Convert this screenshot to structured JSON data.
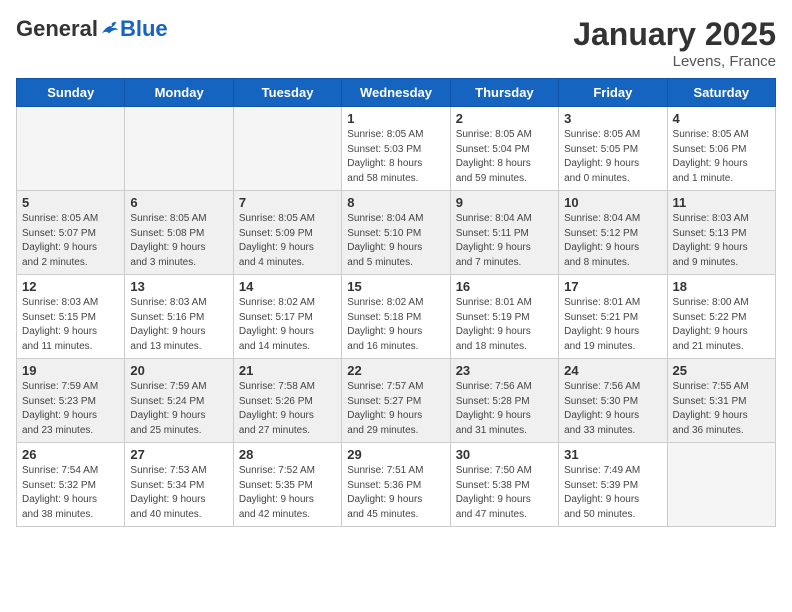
{
  "logo": {
    "general": "General",
    "blue": "Blue"
  },
  "title": "January 2025",
  "subtitle": "Levens, France",
  "weekdays": [
    "Sunday",
    "Monday",
    "Tuesday",
    "Wednesday",
    "Thursday",
    "Friday",
    "Saturday"
  ],
  "weeks": [
    [
      {
        "day": "",
        "info": ""
      },
      {
        "day": "",
        "info": ""
      },
      {
        "day": "",
        "info": ""
      },
      {
        "day": "1",
        "info": "Sunrise: 8:05 AM\nSunset: 5:03 PM\nDaylight: 8 hours\nand 58 minutes."
      },
      {
        "day": "2",
        "info": "Sunrise: 8:05 AM\nSunset: 5:04 PM\nDaylight: 8 hours\nand 59 minutes."
      },
      {
        "day": "3",
        "info": "Sunrise: 8:05 AM\nSunset: 5:05 PM\nDaylight: 9 hours\nand 0 minutes."
      },
      {
        "day": "4",
        "info": "Sunrise: 8:05 AM\nSunset: 5:06 PM\nDaylight: 9 hours\nand 1 minute."
      }
    ],
    [
      {
        "day": "5",
        "info": "Sunrise: 8:05 AM\nSunset: 5:07 PM\nDaylight: 9 hours\nand 2 minutes."
      },
      {
        "day": "6",
        "info": "Sunrise: 8:05 AM\nSunset: 5:08 PM\nDaylight: 9 hours\nand 3 minutes."
      },
      {
        "day": "7",
        "info": "Sunrise: 8:05 AM\nSunset: 5:09 PM\nDaylight: 9 hours\nand 4 minutes."
      },
      {
        "day": "8",
        "info": "Sunrise: 8:04 AM\nSunset: 5:10 PM\nDaylight: 9 hours\nand 5 minutes."
      },
      {
        "day": "9",
        "info": "Sunrise: 8:04 AM\nSunset: 5:11 PM\nDaylight: 9 hours\nand 7 minutes."
      },
      {
        "day": "10",
        "info": "Sunrise: 8:04 AM\nSunset: 5:12 PM\nDaylight: 9 hours\nand 8 minutes."
      },
      {
        "day": "11",
        "info": "Sunrise: 8:03 AM\nSunset: 5:13 PM\nDaylight: 9 hours\nand 9 minutes."
      }
    ],
    [
      {
        "day": "12",
        "info": "Sunrise: 8:03 AM\nSunset: 5:15 PM\nDaylight: 9 hours\nand 11 minutes."
      },
      {
        "day": "13",
        "info": "Sunrise: 8:03 AM\nSunset: 5:16 PM\nDaylight: 9 hours\nand 13 minutes."
      },
      {
        "day": "14",
        "info": "Sunrise: 8:02 AM\nSunset: 5:17 PM\nDaylight: 9 hours\nand 14 minutes."
      },
      {
        "day": "15",
        "info": "Sunrise: 8:02 AM\nSunset: 5:18 PM\nDaylight: 9 hours\nand 16 minutes."
      },
      {
        "day": "16",
        "info": "Sunrise: 8:01 AM\nSunset: 5:19 PM\nDaylight: 9 hours\nand 18 minutes."
      },
      {
        "day": "17",
        "info": "Sunrise: 8:01 AM\nSunset: 5:21 PM\nDaylight: 9 hours\nand 19 minutes."
      },
      {
        "day": "18",
        "info": "Sunrise: 8:00 AM\nSunset: 5:22 PM\nDaylight: 9 hours\nand 21 minutes."
      }
    ],
    [
      {
        "day": "19",
        "info": "Sunrise: 7:59 AM\nSunset: 5:23 PM\nDaylight: 9 hours\nand 23 minutes."
      },
      {
        "day": "20",
        "info": "Sunrise: 7:59 AM\nSunset: 5:24 PM\nDaylight: 9 hours\nand 25 minutes."
      },
      {
        "day": "21",
        "info": "Sunrise: 7:58 AM\nSunset: 5:26 PM\nDaylight: 9 hours\nand 27 minutes."
      },
      {
        "day": "22",
        "info": "Sunrise: 7:57 AM\nSunset: 5:27 PM\nDaylight: 9 hours\nand 29 minutes."
      },
      {
        "day": "23",
        "info": "Sunrise: 7:56 AM\nSunset: 5:28 PM\nDaylight: 9 hours\nand 31 minutes."
      },
      {
        "day": "24",
        "info": "Sunrise: 7:56 AM\nSunset: 5:30 PM\nDaylight: 9 hours\nand 33 minutes."
      },
      {
        "day": "25",
        "info": "Sunrise: 7:55 AM\nSunset: 5:31 PM\nDaylight: 9 hours\nand 36 minutes."
      }
    ],
    [
      {
        "day": "26",
        "info": "Sunrise: 7:54 AM\nSunset: 5:32 PM\nDaylight: 9 hours\nand 38 minutes."
      },
      {
        "day": "27",
        "info": "Sunrise: 7:53 AM\nSunset: 5:34 PM\nDaylight: 9 hours\nand 40 minutes."
      },
      {
        "day": "28",
        "info": "Sunrise: 7:52 AM\nSunset: 5:35 PM\nDaylight: 9 hours\nand 42 minutes."
      },
      {
        "day": "29",
        "info": "Sunrise: 7:51 AM\nSunset: 5:36 PM\nDaylight: 9 hours\nand 45 minutes."
      },
      {
        "day": "30",
        "info": "Sunrise: 7:50 AM\nSunset: 5:38 PM\nDaylight: 9 hours\nand 47 minutes."
      },
      {
        "day": "31",
        "info": "Sunrise: 7:49 AM\nSunset: 5:39 PM\nDaylight: 9 hours\nand 50 minutes."
      },
      {
        "day": "",
        "info": ""
      }
    ]
  ]
}
